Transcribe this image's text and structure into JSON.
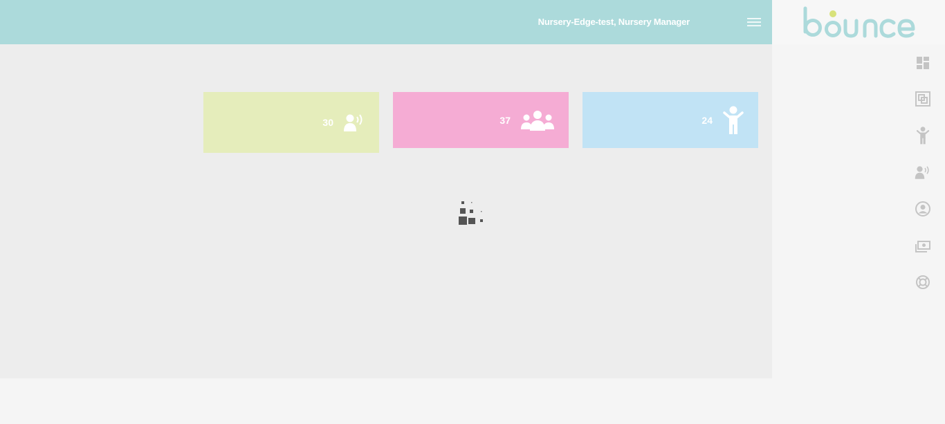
{
  "header": {
    "user_label": "Nursery-Edge-test, Nursery Manager",
    "menu_icon": "hamburger-menu-icon"
  },
  "brand": {
    "logo_text": "bounce",
    "color": "#acdadb",
    "dot_color": "#d8e27a"
  },
  "sidebar": {
    "items": [
      {
        "icon": "dashboard-icon"
      },
      {
        "icon": "rooms-icon"
      },
      {
        "icon": "child-icon"
      },
      {
        "icon": "staff-icon"
      },
      {
        "icon": "user-profile-icon"
      },
      {
        "icon": "finance-icon"
      },
      {
        "icon": "support-lifebuoy-icon"
      }
    ]
  },
  "cards": [
    {
      "value": "30",
      "icon": "staff-speaking-icon",
      "color": "#e5edbb"
    },
    {
      "value": "37",
      "icon": "group-icon",
      "color": "#f5acd4"
    },
    {
      "value": "24",
      "icon": "child-icon",
      "color": "#c1e3f5"
    }
  ],
  "loading": {
    "icon": "loading-spinner-icon"
  }
}
